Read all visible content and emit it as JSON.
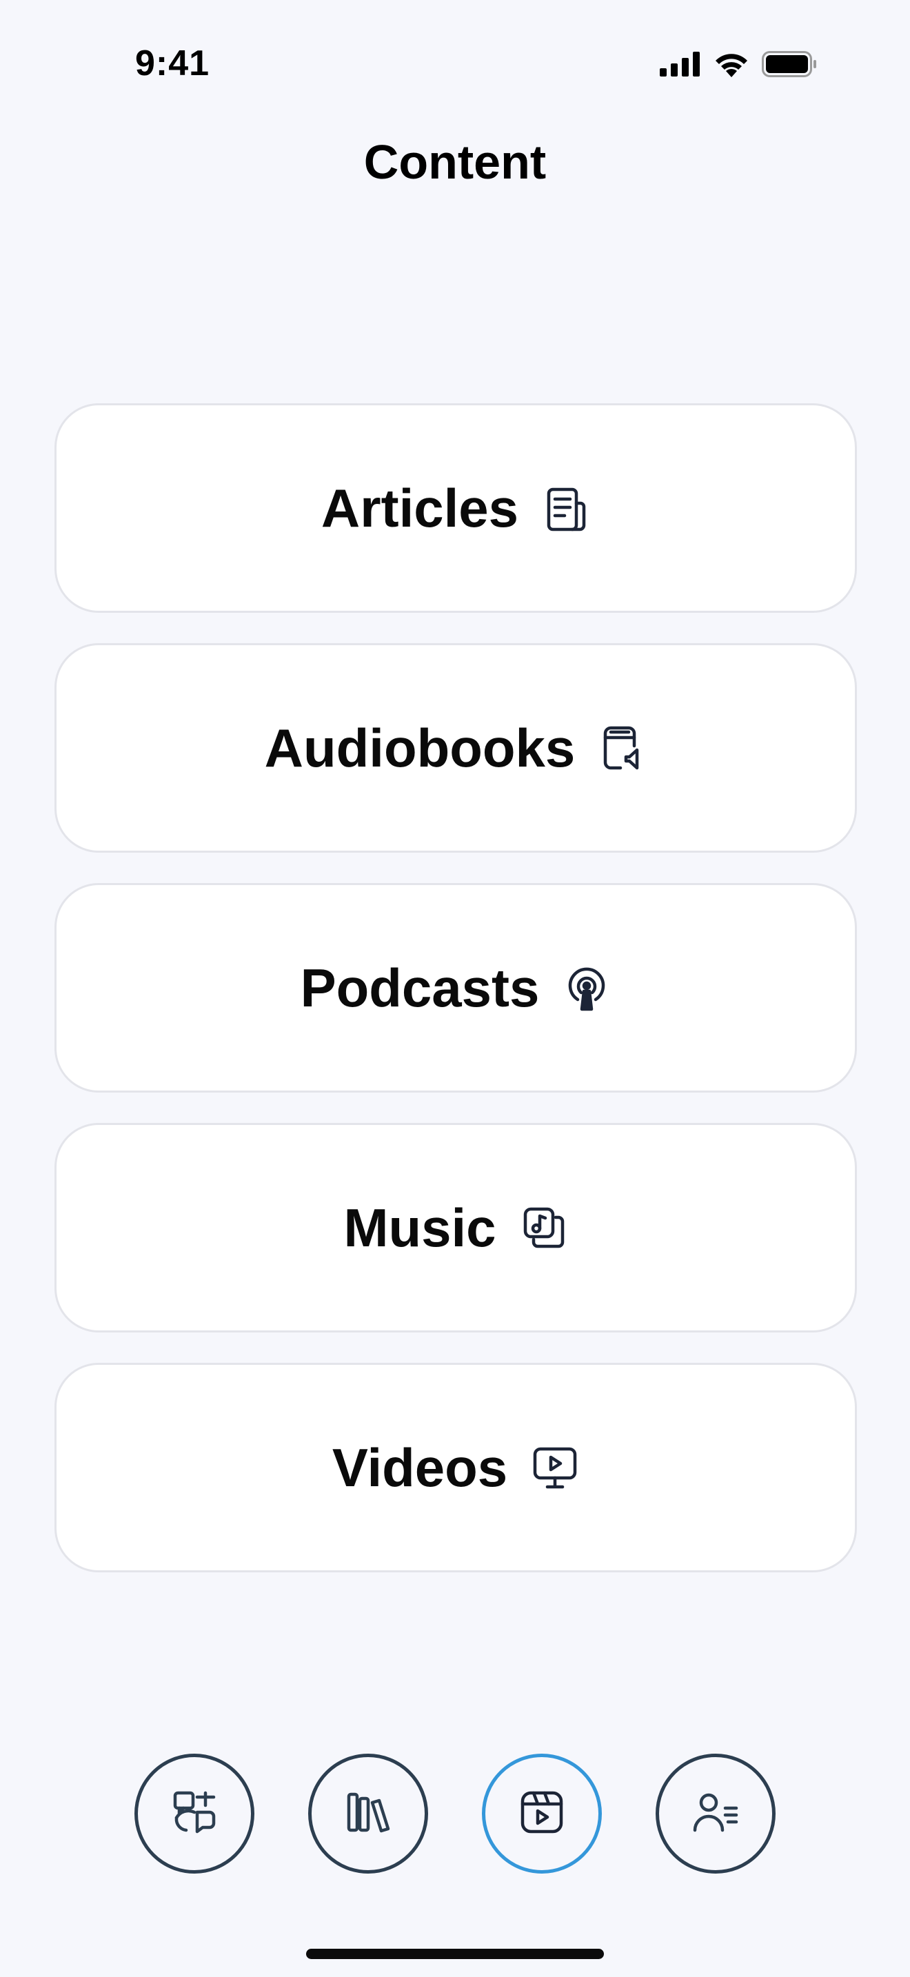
{
  "status_bar": {
    "time": "9:41",
    "icons": [
      "cellular-signal-icon",
      "wifi-icon",
      "battery-icon"
    ]
  },
  "header": {
    "title": "Content"
  },
  "content_items": [
    {
      "label": "Articles",
      "icon": "newspaper-icon"
    },
    {
      "label": "Audiobooks",
      "icon": "audiobook-icon"
    },
    {
      "label": "Podcasts",
      "icon": "podcast-icon"
    },
    {
      "label": "Music",
      "icon": "music-icon"
    },
    {
      "label": "Videos",
      "icon": "video-icon"
    }
  ],
  "tab_bar": {
    "tabs": [
      {
        "icon": "language-translate-icon",
        "active": false
      },
      {
        "icon": "library-icon",
        "active": false
      },
      {
        "icon": "content-play-icon",
        "active": true
      },
      {
        "icon": "profile-list-icon",
        "active": false
      }
    ],
    "active_color": "#3497da",
    "inactive_color": "#2c3e50"
  },
  "colors": {
    "background": "#f6f7fc",
    "card_background": "#ffffff",
    "card_border": "#e3e4ea",
    "icon_stroke": "#1c2436"
  }
}
